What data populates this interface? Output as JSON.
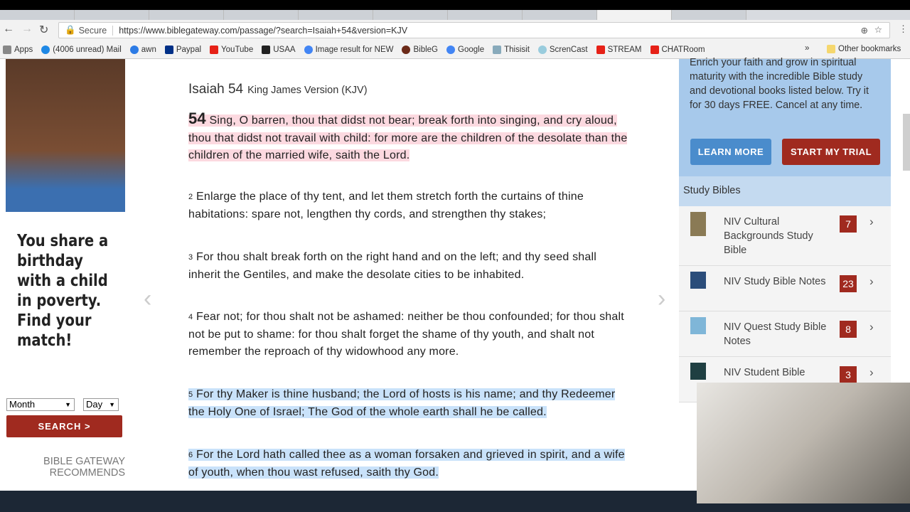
{
  "browser": {
    "secure": "Secure",
    "url": "https://www.biblegateway.com/passage/?search=Isaiah+54&version=KJV"
  },
  "bookmarks": [
    "Apps",
    "(4006 unread) Mail",
    "awn",
    "Paypal",
    "YouTube",
    "USAA",
    "Image result for NEW",
    "BibleG",
    "Google",
    "Thisisit",
    "ScrenCast",
    "STREAM",
    "CHATRoom"
  ],
  "bookmarks_more": "»",
  "other_bookmarks": "Other bookmarks",
  "ad": {
    "text": "You share a birthday with a child in poverty. Find your match!",
    "month": "Month",
    "day": "Day",
    "search": "SEARCH >",
    "recommends": "BIBLE GATEWAY RECOMMENDS"
  },
  "passage": {
    "book": "Isaiah 54",
    "version": "King James Version (KJV)",
    "verses": [
      {
        "num": "54",
        "text": "Sing, O barren, thou that didst not bear; break forth into singing, and cry aloud, thou that didst not travail with child: for more are the children of the desolate than the children of the married wife, saith the Lord."
      },
      {
        "num": "2",
        "text": "Enlarge the place of thy tent, and let them stretch forth the curtains of thine habitations: spare not, lengthen thy cords, and strengthen thy stakes;"
      },
      {
        "num": "3",
        "text": "For thou shalt break forth on the right hand and on the left; and thy seed shall inherit the Gentiles, and make the desolate cities to be inhabited."
      },
      {
        "num": "4",
        "text": "Fear not; for thou shalt not be ashamed: neither be thou confounded; for thou shalt not be put to shame: for thou shalt forget the shame of thy youth, and shalt not remember the reproach of thy widowhood any more."
      },
      {
        "num": "5",
        "text": "For thy Maker is thine husband; the Lord of hosts is his name; and thy Redeemer the Holy One of Israel; The God of the whole earth shall he be called."
      },
      {
        "num": "6",
        "text": "For the Lord hath called thee as a woman forsaken and grieved in spirit, and a wife of youth, when thou wast refused, saith thy God."
      }
    ]
  },
  "sidebar": {
    "promo": "Enrich your faith and grow in spiritual maturity with the incredible Bible study and devotional books listed below. Try it for 30 days FREE. Cancel at any time.",
    "learn_more": "LEARN MORE",
    "start_trial": "START MY TRIAL",
    "heading": "Study Bibles",
    "items": [
      {
        "label": "NIV Cultural Backgrounds Study Bible",
        "count": "7"
      },
      {
        "label": "NIV Study Bible Notes",
        "count": "23"
      },
      {
        "label": "NIV Quest Study Bible Notes",
        "count": "8"
      },
      {
        "label": "NIV Student Bible",
        "count": "3"
      }
    ]
  },
  "colors": {
    "accent_red": "#a02a1f",
    "learn_blue": "#4a8ccc",
    "pink_highlight": "#fcd9e0",
    "blue_highlight": "#c9e2fa"
  }
}
